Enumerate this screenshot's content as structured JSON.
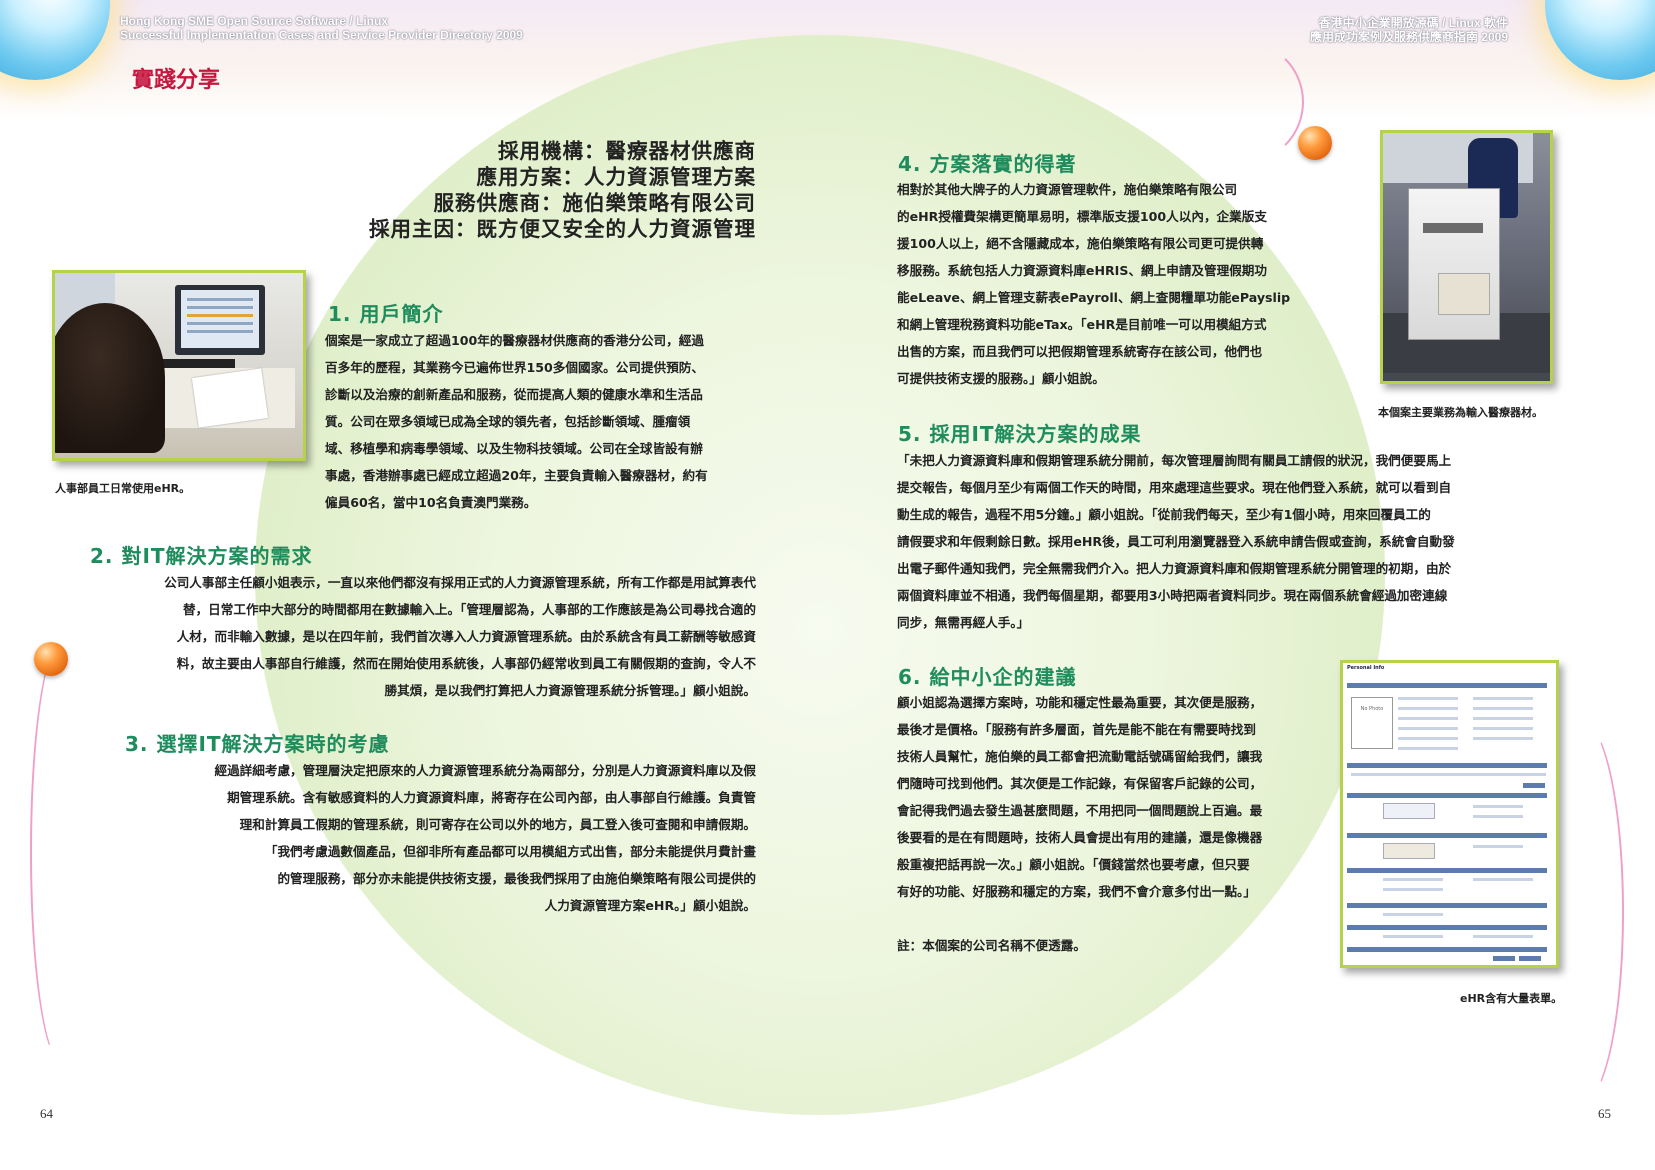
{
  "header": {
    "left_line1": "Hong Kong SME Open Source Software / Linux",
    "left_line2": "Successful Implementation Cases and Service Provider Directory 2009",
    "right_line1": "香港中小企業開放源碼 / Linux 軟件",
    "right_line2": "應用成功案例及服務供應商指南 2009"
  },
  "section_tag": "實踐分享",
  "title_block": {
    "line1": "採用機構：醫療器材供應商",
    "line2": "應用方案：人力資源管理方案",
    "line3": "服務供應商：施伯樂策略有限公司",
    "line4": "採用主因：既方便又安全的人力資源管理"
  },
  "sections": {
    "s1": {
      "heading": "1. 用戶簡介",
      "lines": [
        "個案是一家成立了超過100年的醫療器材供應商的香港分公司，經過",
        "百多年的歷程，其業務今已遍佈世界150多個國家。公司提供預防、",
        "診斷以及治療的創新產品和服務，從而提高人類的健康水準和生活品",
        "質。公司在眾多領域已成為全球的領先者，包括診斷領域、腫瘤領",
        "域、移植學和病毒學領域、以及生物科技領域。公司在全球皆設有辦",
        "事處，香港辦事處已經成立超過20年，主要負責輸入醫療器材，約有",
        "僱員60名，當中10名負責澳門業務。"
      ]
    },
    "s2": {
      "heading": "2. 對IT解決方案的需求",
      "lines": [
        "公司人事部主任顧小姐表示，一直以來他們都沒有採用正式的人力資源管理系統，所有工作都是用試算表代",
        "替，日常工作中大部分的時間都用在數據輸入上。「管理層認為，人事部的工作應該是為公司尋找合適的",
        "人材，而非輸入數據，是以在四年前，我們首次導入人力資源管理系統。由於系統含有員工薪酬等敏感資",
        "料，故主要由人事部自行維護，然而在開始使用系統後，人事部仍經常收到員工有關假期的查詢，令人不",
        "勝其煩，是以我們打算把人力資源管理系統分拆管理。」顧小姐說。"
      ]
    },
    "s3": {
      "heading": "3. 選擇IT解決方案時的考慮",
      "lines": [
        "經過詳細考慮，管理層決定把原來的人力資源管理系統分為兩部分，分別是人力資源資料庫以及假",
        "期管理系統。含有敏感資料的人力資源資料庫，將寄存在公司內部，由人事部自行維護。負責管",
        "理和計算員工假期的管理系統，則可寄存在公司以外的地方，員工登入後可查閱和申請假期。",
        "「我們考慮過數個產品，但卻非所有產品都可以用模組方式出售，部分未能提供月費計畫",
        "的管理服務，部分亦未能提供技術支援，最後我們採用了由施伯樂策略有限公司提供的",
        "人力資源管理方案eHR。」顧小姐說。"
      ]
    },
    "s4": {
      "heading": "4. 方案落實的得著",
      "lines": [
        "相對於其他大牌子的人力資源管理軟件，施伯樂策略有限公司",
        "的eHR授權費架構更簡單易明，標準版支援100人以內，企業版支",
        "援100人以上，絕不含隱藏成本，施伯樂策略有限公司更可提供轉",
        "移服務。系統包括人力資源資料庫eHRIS、網上申請及管理假期功",
        "能eLeave、網上管理支薪表ePayroll、網上查閱糧單功能ePayslip",
        "和網上管理稅務資料功能eTax。「eHR是目前唯一可以用模組方式",
        "出售的方案，而且我們可以把假期管理系統寄存在該公司，他們也",
        "可提供技術支援的服務。」顧小姐說。"
      ]
    },
    "s5": {
      "heading": "5. 採用IT解決方案的成果",
      "lines": [
        "「未把人力資源資料庫和假期管理系統分開前，每次管理層詢問有關員工請假的狀況，我們便要馬上",
        "提交報告，每個月至少有兩個工作天的時間，用來處理這些要求。現在他們登入系統，就可以看到自",
        "動生成的報告，過程不用5分鐘。」顧小姐說。「從前我們每天，至少有1個小時，用來回覆員工的",
        "請假要求和年假剩餘日數。採用eHR後，員工可利用瀏覽器登入系統申請告假或查詢，系統會自動發",
        "出電子郵件通知我們，完全無需我們介入。把人力資源資料庫和假期管理系統分開管理的初期，由於",
        "兩個資料庫並不相通，我們每個星期，都要用3小時把兩者資料同步。現在兩個系統會經過加密連線",
        "同步，無需再經人手。」"
      ]
    },
    "s6": {
      "heading": "6. 給中小企的建議",
      "lines": [
        "顧小姐認為選擇方案時，功能和穩定性最為重要，其次便是服務，",
        "最後才是價格。「服務有許多層面，首先是能不能在有需要時找到",
        "技術人員幫忙，施伯樂的員工都會把流動電話號碼留給我們，讓我",
        "們隨時可找到他們。其次便是工作記錄，有保留客戶記錄的公司，",
        "會記得我們過去發生過甚麼問題，不用把同一個問題說上百遍。最",
        "後要看的是在有問題時，技術人員會提出有用的建議，還是像機器",
        "般重複把話再說一次。」顧小姐說。「價錢當然也要考慮，但只要",
        "有好的功能、好服務和穩定的方案，我們不會介意多付出一點。」"
      ],
      "note": "註：本個案的公司名稱不便透露。"
    }
  },
  "captions": {
    "photo1": "人事部員工日常使用eHR。",
    "photo2": "本個案主要業務為輸入醫療器材。",
    "photo3": "eHR含有大量表單。"
  },
  "form_screenshot": {
    "title": "Personal Info",
    "photo_placeholder": "No Photo"
  },
  "page_numbers": {
    "left": "64",
    "right": "65"
  },
  "colors": {
    "heading_green": "#1e8c5c",
    "tag_red": "#c5173f",
    "frame_green": "#b6d14a",
    "orb_orange": "#ff9b3d"
  }
}
